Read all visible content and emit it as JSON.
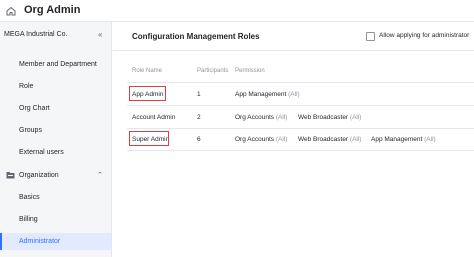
{
  "header": {
    "title": "Org Admin",
    "home_icon": "home-icon"
  },
  "sidebar": {
    "company": "MEGA Industrial Co.",
    "collapse_icon": "double-chevron-left-icon",
    "items": [
      {
        "label": "Member and Department"
      },
      {
        "label": "Role"
      },
      {
        "label": "Org Chart"
      },
      {
        "label": "Groups"
      },
      {
        "label": "External users"
      }
    ],
    "section": {
      "label": "Organization",
      "icon": "folder-icon",
      "chevron": "chevron-up-icon"
    },
    "section_items": [
      {
        "label": "Basics"
      },
      {
        "label": "Billing"
      },
      {
        "label": "Administrator",
        "active": true
      }
    ],
    "accent": "#3370ff"
  },
  "main": {
    "title": "Configuration Management Roles",
    "checkbox_label": "Allow applying for administrator",
    "columns": {
      "role": "Role Name",
      "participants": "Participants",
      "permission": "Permission"
    },
    "rows": [
      {
        "role": "App Admin",
        "participants": "1",
        "permissions": [
          {
            "name": "App Management",
            "scope": "(All)"
          }
        ]
      },
      {
        "role": "Account Admin",
        "participants": "2",
        "permissions": [
          {
            "name": "Org Accounts",
            "scope": "(All)"
          }
        ]
      },
      {
        "role": "Super Admin",
        "participants": "6",
        "permissions": [
          {
            "name": "Org Accounts",
            "scope": "(All)"
          },
          {
            "name": "Web Broadcaster",
            "scope": "(All)"
          },
          {
            "name": "App Management",
            "scope": "(All)"
          }
        ]
      }
    ],
    "row1_web_broadcaster": {
      "name": "Web Broadcaster",
      "scope": "(All)"
    },
    "highlight_color": "#e03e3e"
  }
}
